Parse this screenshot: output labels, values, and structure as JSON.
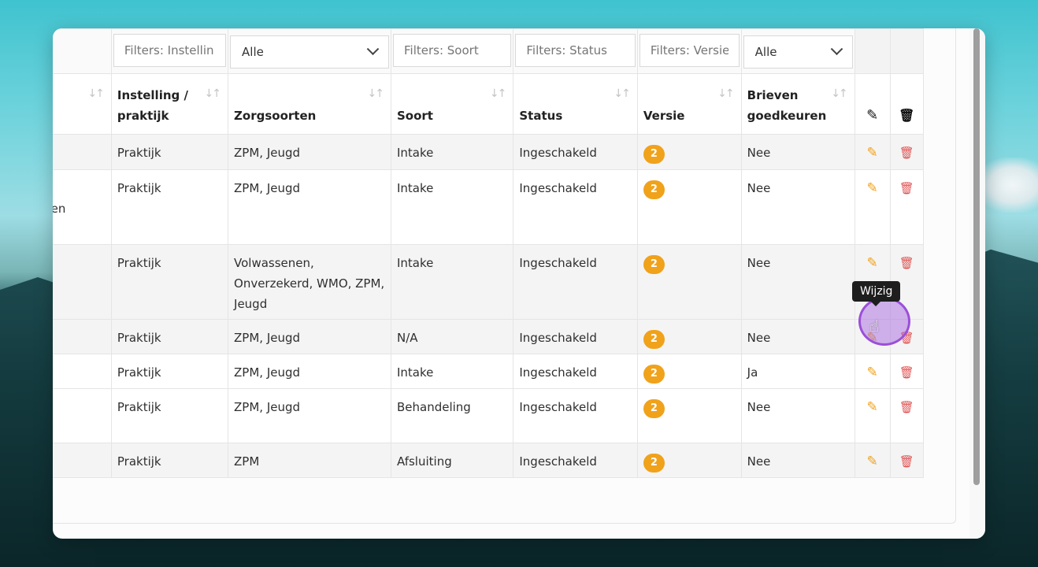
{
  "filters": {
    "instelling_placeholder": "Filters: Instellin",
    "zorgsoorten_selected": "Alle",
    "soort_placeholder": "Filters: Soort",
    "status_placeholder": "Filters: Status",
    "versie_placeholder": "Filters: Versie",
    "brieven_selected": "Alle"
  },
  "columns": {
    "instelling_line1": "Instelling /",
    "instelling_line2": "praktijk",
    "zorgsoorten": "Zorgsoorten",
    "soort": "Soort",
    "status": "Status",
    "versie": "Versie",
    "brieven_line1": "Brieven",
    "brieven_line2": "goedkeuren"
  },
  "rows": [
    {
      "prev": "",
      "instelling": "Praktijk",
      "zorgsoorten": "ZPM, Jeugd",
      "soort": "Intake",
      "status": "Ingeschakeld",
      "versie": "2",
      "brieven": "Nee"
    },
    {
      "prev": "r geen",
      "instelling": "Praktijk",
      "zorgsoorten": "ZPM, Jeugd",
      "soort": "Intake",
      "status": "Ingeschakeld",
      "versie": "2",
      "brieven": "Nee"
    },
    {
      "prev": "",
      "instelling": "Praktijk",
      "zorgsoorten": "Volwassenen, Onverzekerd, WMO, ZPM, Jeugd",
      "soort": "Intake",
      "status": "Ingeschakeld",
      "versie": "2",
      "brieven": "Nee"
    },
    {
      "prev": "",
      "instelling": "Praktijk",
      "zorgsoorten": "ZPM, Jeugd",
      "soort": "N/A",
      "status": "Ingeschakeld",
      "versie": "2",
      "brieven": "Nee"
    },
    {
      "prev": "",
      "instelling": "Praktijk",
      "zorgsoorten": "ZPM, Jeugd",
      "soort": "Intake",
      "status": "Ingeschakeld",
      "versie": "2",
      "brieven": "Ja"
    },
    {
      "prev": "",
      "instelling": "Praktijk",
      "zorgsoorten": "ZPM, Jeugd",
      "soort": "Behandeling",
      "status": "Ingeschakeld",
      "versie": "2",
      "brieven": "Nee"
    },
    {
      "prev": "",
      "instelling": "Praktijk",
      "zorgsoorten": "ZPM",
      "soort": "Afsluiting",
      "status": "Ingeschakeld",
      "versie": "2",
      "brieven": "Nee"
    }
  ],
  "tooltip": "Wijzig",
  "icons": {
    "sort": "sort-arrows-icon",
    "edit": "pencil-icon",
    "delete": "trash-icon",
    "cursor": "hand-pointer-icon"
  },
  "colors": {
    "badge": "#f0a21b",
    "edit": "#f0a21b",
    "delete": "#e05252",
    "cursor_highlight": "#9b4fd8"
  }
}
